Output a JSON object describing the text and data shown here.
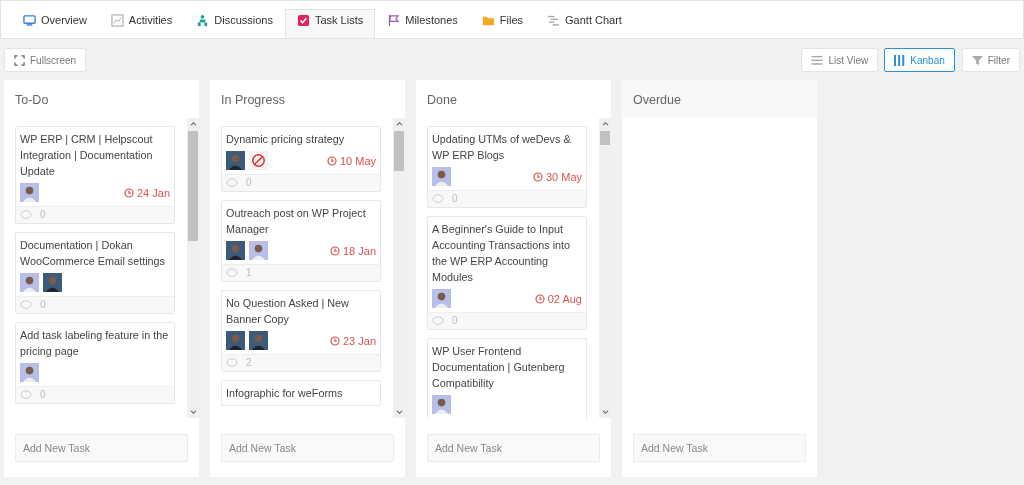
{
  "tabs": [
    {
      "label": "Overview",
      "selected": false
    },
    {
      "label": "Activities",
      "selected": false
    },
    {
      "label": "Discussions",
      "selected": false
    },
    {
      "label": "Task Lists",
      "selected": true
    },
    {
      "label": "Milestones",
      "selected": false
    },
    {
      "label": "Files",
      "selected": false
    },
    {
      "label": "Gantt Chart",
      "selected": false
    }
  ],
  "fullscreen": "Fullscreen",
  "views": [
    {
      "label": "List View",
      "selected": false
    },
    {
      "label": "Kanban",
      "selected": true
    }
  ],
  "filter": "Filter",
  "columns": [
    {
      "title": "To-Do",
      "placeholder": "Add New Task",
      "tasks": [
        {
          "title": "WP ERP | CRM | Helpscout Integration | Documentation Update",
          "assignees": [
            {
              "kind": "light"
            }
          ],
          "due": "24 Jan",
          "comments": "0"
        },
        {
          "title": "Documentation | Dokan WooCommerce Email settings",
          "assignees": [
            {
              "kind": "light"
            },
            {
              "kind": "dark"
            }
          ],
          "comments": "0"
        },
        {
          "title": "Add task labeling feature in the pricing page",
          "assignees": [
            {
              "kind": "light"
            }
          ],
          "comments": "0"
        }
      ]
    },
    {
      "title": "In Progress",
      "placeholder": "Add New Task",
      "tasks": [
        {
          "title": "Dynamic pricing strategy",
          "assignees": [
            {
              "kind": "dark"
            },
            {
              "kind": "logo"
            }
          ],
          "due": "10 May",
          "comments": "0"
        },
        {
          "title": "Outreach post on WP Project Manager",
          "assignees": [
            {
              "kind": "dark"
            },
            {
              "kind": "light"
            }
          ],
          "due": "18 Jan",
          "comments": "1"
        },
        {
          "title": "No Question Asked | New Banner Copy",
          "assignees": [
            {
              "kind": "dark"
            },
            {
              "kind": "dark"
            }
          ],
          "due": "23 Jan",
          "comments": "2"
        },
        {
          "title": "Infographic for weForms"
        }
      ]
    },
    {
      "title": "Done",
      "placeholder": "Add New Task",
      "tasks": [
        {
          "title": "Updating UTMs of weDevs & WP ERP Blogs",
          "assignees": [
            {
              "kind": "light"
            }
          ],
          "due": "30 May",
          "comments": "0"
        },
        {
          "title": "A Beginner's Guide to Input Accounting Transactions into the WP ERP Accounting Modules",
          "assignees": [
            {
              "kind": "light"
            }
          ],
          "due": "02 Aug",
          "comments": "0"
        },
        {
          "title": "WP User Frontend Documentation | Gutenberg Compatibility",
          "assignees": [
            {
              "kind": "light"
            }
          ]
        }
      ]
    },
    {
      "title": "Overdue",
      "placeholder": "Add New Task"
    }
  ]
}
